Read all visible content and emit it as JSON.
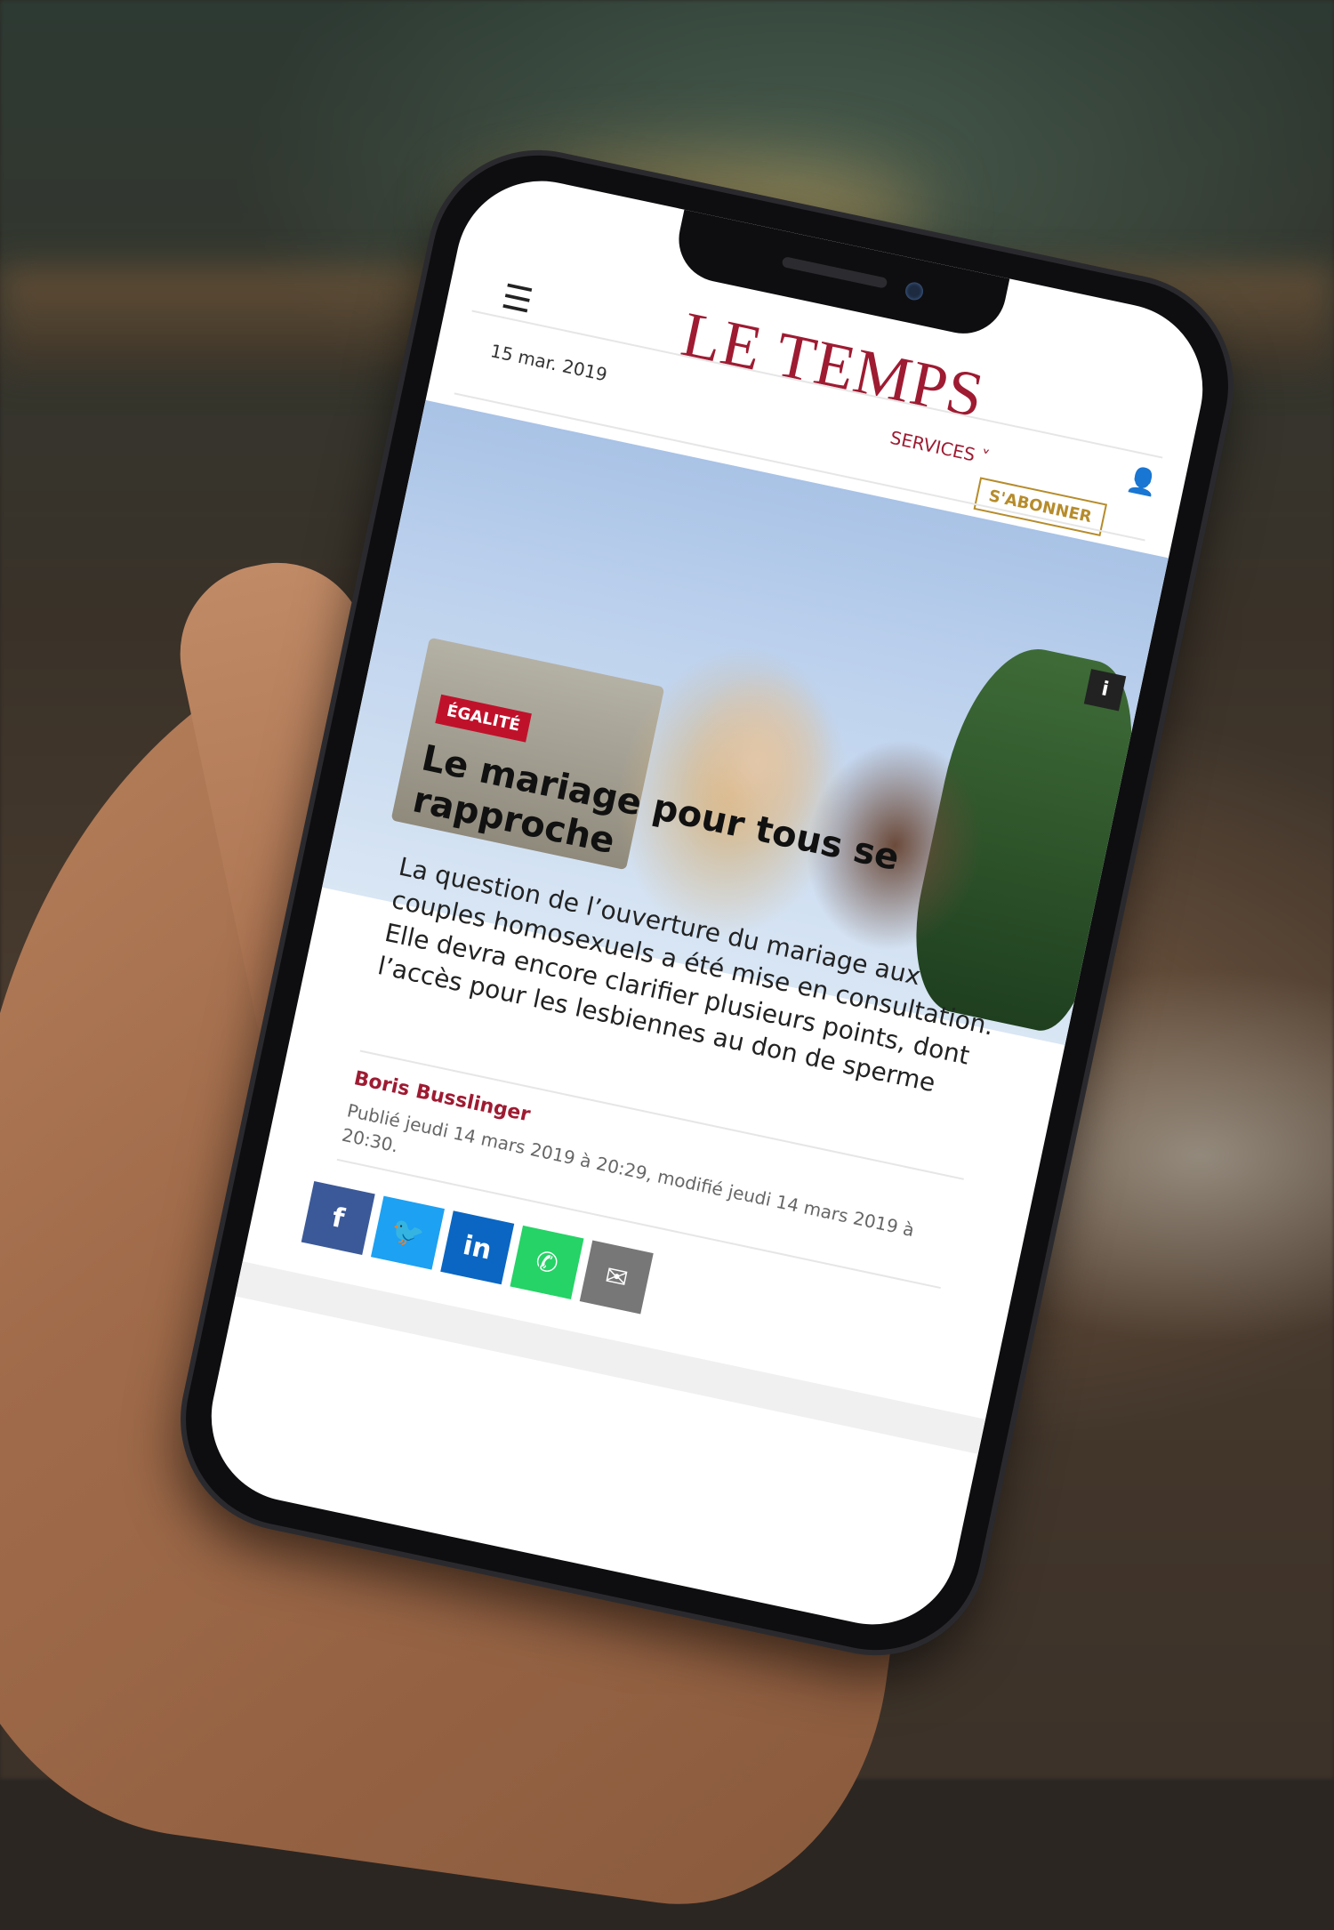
{
  "app": {
    "logo": "LE TEMPS",
    "date": "15 mar. 2019",
    "services": "SERVICES",
    "subscribe": "S'ABONNER",
    "menu_icon": "hamburger-icon",
    "user_icon": "user-icon"
  },
  "article": {
    "tag": "ÉGALITÉ",
    "headline": "Le mariage pour tous se rapproche",
    "lead": "La question de l’ouverture du mariage aux couples homosexuels a été mise en consultation. Elle devra encore clarifier plusieurs points, dont l’accès pour les lesbiennes au don de sperme",
    "author": "Boris Busslinger",
    "meta": "Publié jeudi 14 mars 2019 à 20:29, modifié jeudi 14 mars 2019 à 20:30.",
    "info_icon": "info-icon"
  },
  "share": [
    {
      "name": "facebook",
      "icon": "facebook-icon",
      "color": "#3b5998",
      "label": "f"
    },
    {
      "name": "twitter",
      "icon": "twitter-icon",
      "color": "#1da1f2",
      "label": "🐦"
    },
    {
      "name": "linkedin",
      "icon": "linkedin-icon",
      "color": "#0a66c2",
      "label": "in"
    },
    {
      "name": "whatsapp",
      "icon": "whatsapp-icon",
      "color": "#25d366",
      "label": "✆"
    },
    {
      "name": "email",
      "icon": "mail-icon",
      "color": "#777777",
      "label": "✉"
    }
  ],
  "colors": {
    "brand": "#9e1b32",
    "accent_gold": "#b68c2b",
    "tag_red": "#c0112b"
  }
}
